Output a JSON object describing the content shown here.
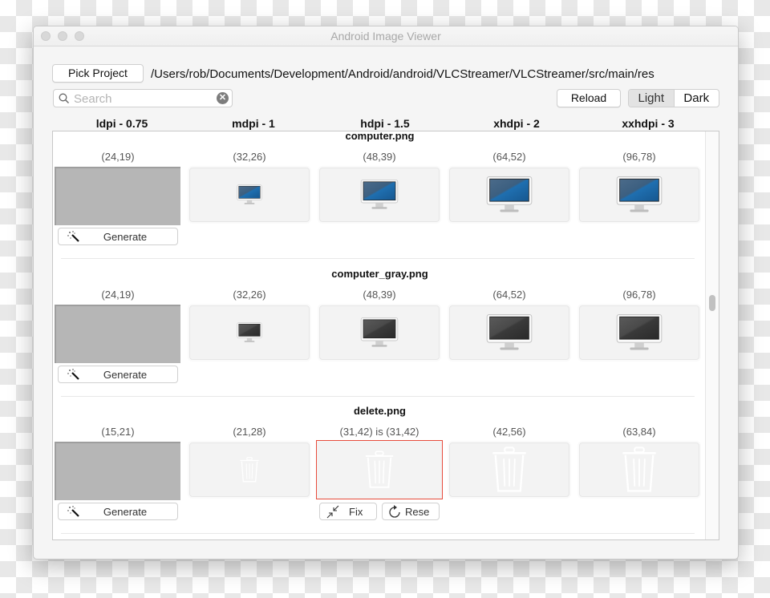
{
  "window": {
    "title": "Android Image Viewer"
  },
  "toolbar": {
    "pick_project_label": "Pick Project",
    "project_path": "/Users/rob/Documents/Development/Android/android/VLCStreamer/VLCStreamer/src/main/res",
    "search_placeholder": "Search",
    "search_value": "",
    "reload_label": "Reload",
    "theme_options": [
      "Light",
      "Dark"
    ],
    "theme_selected": "Light"
  },
  "columns": [
    {
      "label": "ldpi - 0.75"
    },
    {
      "label": "mdpi - 1"
    },
    {
      "label": "hdpi - 1.5"
    },
    {
      "label": "xhdpi - 2"
    },
    {
      "label": "xxhdpi - 3"
    }
  ],
  "resources": [
    {
      "name": "computer.png",
      "icon": "computer-blue-icon",
      "cells": [
        {
          "size": "(24,19)",
          "state": "missing",
          "action": "Generate"
        },
        {
          "size": "(32,26)",
          "state": "ok"
        },
        {
          "size": "(48,39)",
          "state": "ok"
        },
        {
          "size": "(64,52)",
          "state": "ok"
        },
        {
          "size": "(96,78)",
          "state": "ok"
        }
      ]
    },
    {
      "name": "computer_gray.png",
      "icon": "computer-gray-icon",
      "cells": [
        {
          "size": "(24,19)",
          "state": "missing",
          "action": "Generate"
        },
        {
          "size": "(32,26)",
          "state": "ok"
        },
        {
          "size": "(48,39)",
          "state": "ok"
        },
        {
          "size": "(64,52)",
          "state": "ok"
        },
        {
          "size": "(96,78)",
          "state": "ok"
        }
      ]
    },
    {
      "name": "delete.png",
      "icon": "trash-icon",
      "cells": [
        {
          "size": "(15,21)",
          "state": "missing",
          "action": "Generate"
        },
        {
          "size": "(21,28)",
          "state": "ok"
        },
        {
          "size": "(31,42)  is (31,42)",
          "state": "error",
          "fix_label": "Fix",
          "reset_label": "Rese"
        },
        {
          "size": "(42,56)",
          "state": "ok"
        },
        {
          "size": "(63,84)",
          "state": "ok"
        }
      ]
    }
  ],
  "colors": {
    "error_border": "#e74c3c",
    "screen_blue": "#1f6fb0",
    "screen_gray": "#3a3a3a"
  }
}
